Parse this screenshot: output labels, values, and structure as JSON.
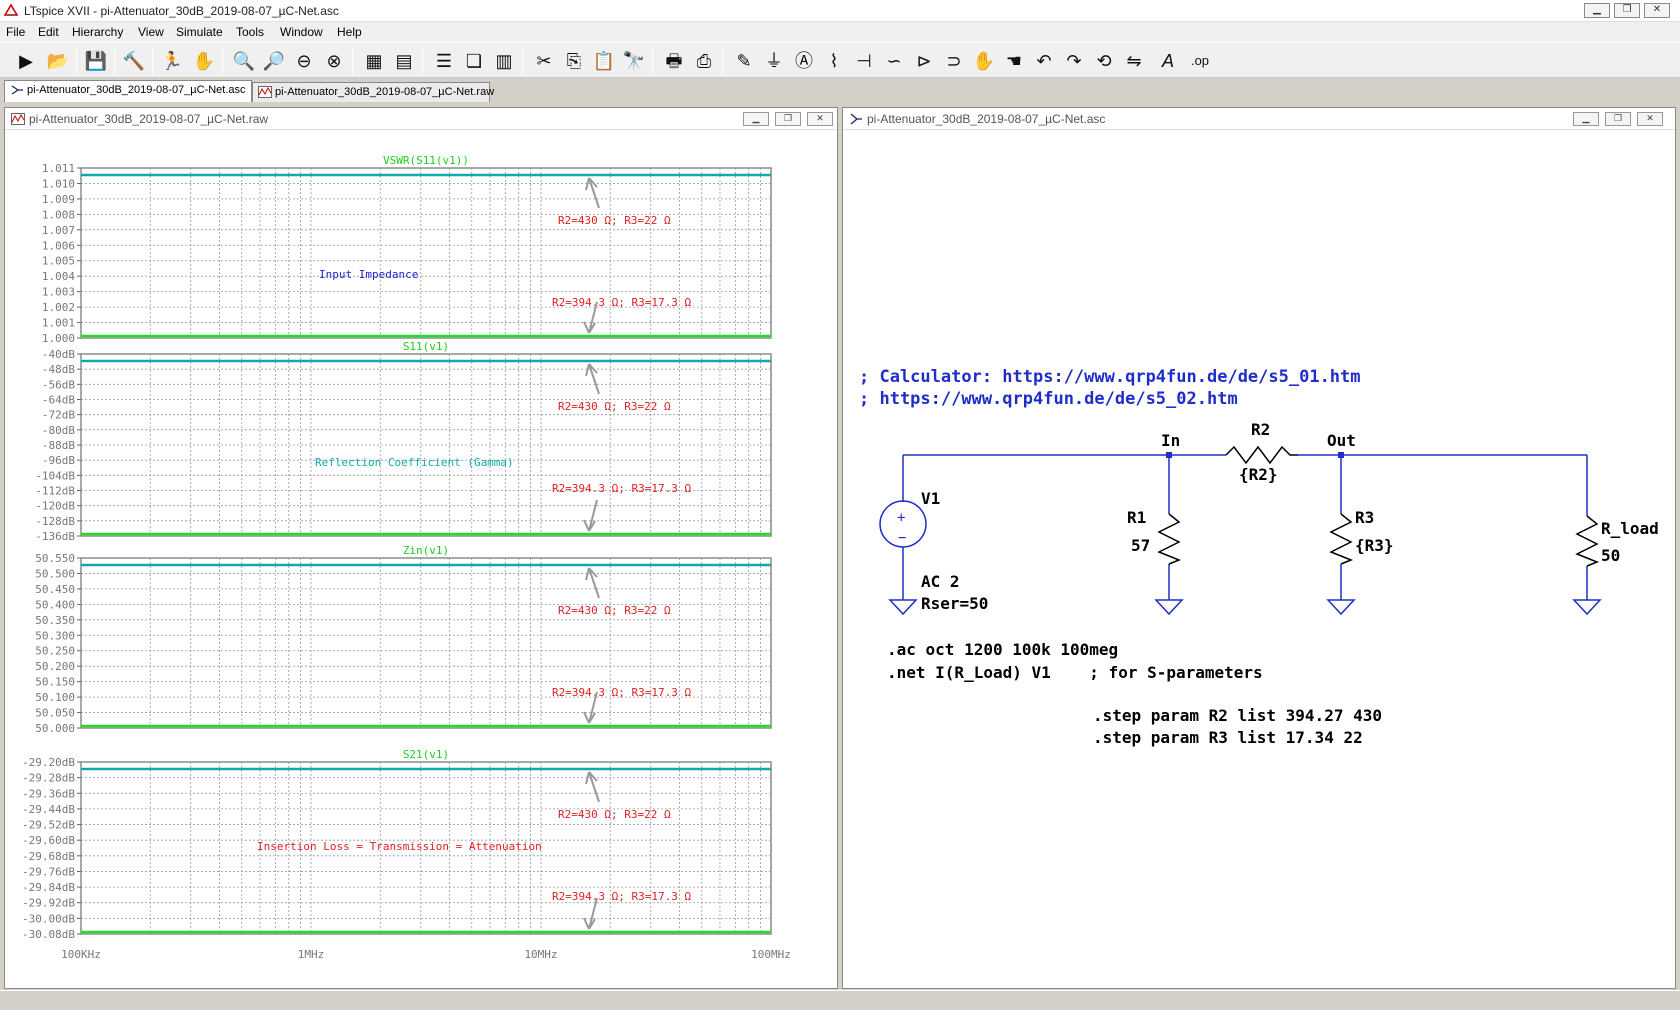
{
  "window": {
    "title": "LTspice XVII - pi-Attenuator_30dB_2019-08-07_µC-Net.asc"
  },
  "menu": [
    "File",
    "Edit",
    "Hierarchy",
    "View",
    "Simulate",
    "Tools",
    "Window",
    "Help"
  ],
  "tabs": [
    {
      "label": "pi-Attenuator_30dB_2019-08-07_µC-Net.asc"
    },
    {
      "label": "pi-Attenuator_30dB_2019-08-07_µC-Net.raw"
    }
  ],
  "waveform_window": {
    "title": "pi-Attenuator_30dB_2019-08-07_µC-Net.raw",
    "x_ticks": [
      "100KHz",
      "1MHz",
      "10MHz",
      "100MHz"
    ],
    "panes": [
      {
        "trace": "VSWR(S11(v1))",
        "y_ticks": [
          "1.011",
          "1.010",
          "1.009",
          "1.008",
          "1.007",
          "1.006",
          "1.005",
          "1.004",
          "1.003",
          "1.002",
          "1.001",
          "1.000"
        ],
        "annot_main": "Input Impedance",
        "annot_top": "R2=430 Ω; R3=22 Ω",
        "annot_bot": "R2=394.3 Ω; R3=17.3 Ω",
        "main_color": "#2222cc"
      },
      {
        "trace": "S11(v1)",
        "y_ticks": [
          "-40dB",
          "-48dB",
          "-56dB",
          "-64dB",
          "-72dB",
          "-80dB",
          "-88dB",
          "-96dB",
          "-104dB",
          "-112dB",
          "-120dB",
          "-128dB",
          "-136dB"
        ],
        "annot_main": "Reflection Coefficient (Gamma)",
        "annot_top": "R2=430 Ω; R3=22 Ω",
        "annot_bot": "R2=394.3 Ω; R3=17.3 Ω",
        "main_color": "#11aaaa"
      },
      {
        "trace": "Zin(v1)",
        "y_ticks": [
          "50.550",
          "50.500",
          "50.450",
          "50.400",
          "50.350",
          "50.300",
          "50.250",
          "50.200",
          "50.150",
          "50.100",
          "50.050",
          "50.000"
        ],
        "annot_main": "",
        "annot_top": "R2=430 Ω; R3=22 Ω",
        "annot_bot": "R2=394.3 Ω; R3=17.3 Ω",
        "main_color": "#2222cc"
      },
      {
        "trace": "S21(v1)",
        "y_ticks": [
          "-29.20dB",
          "-29.28dB",
          "-29.36dB",
          "-29.44dB",
          "-29.52dB",
          "-29.60dB",
          "-29.68dB",
          "-29.76dB",
          "-29.84dB",
          "-29.92dB",
          "-30.00dB",
          "-30.08dB"
        ],
        "annot_main": "Insertion Loss = Transmission = Attenuation",
        "annot_top": "R2=430 Ω; R3=22 Ω",
        "annot_bot": "R2=394.3 Ω; R3=17.3 Ω",
        "main_color": "#dd2222"
      }
    ]
  },
  "schematic_window": {
    "title": "pi-Attenuator_30dB_2019-08-07_µC-Net.asc",
    "comment1": "; Calculator: https://www.qrp4fun.de/de/s5_01.htm",
    "comment2": "; https://www.qrp4fun.de/de/s5_02.htm",
    "labels": {
      "in": "In",
      "out": "Out",
      "r2": "R2",
      "r2v": "{R2}",
      "r1": "R1",
      "r1v": "57",
      "r3": "R3",
      "r3v": "{R3}",
      "rload": "R_load",
      "rloadv": "50",
      "v1": "V1",
      "ac": "AC 2",
      "rser": "Rser=50"
    },
    "directives": [
      ".ac oct 1200 100k 100meg",
      ".net I(R_Load) V1    ; for S-parameters"
    ],
    "steps": [
      ".step param R2 list 394.27 430",
      ".step param R3 list 17.34 22"
    ]
  }
}
